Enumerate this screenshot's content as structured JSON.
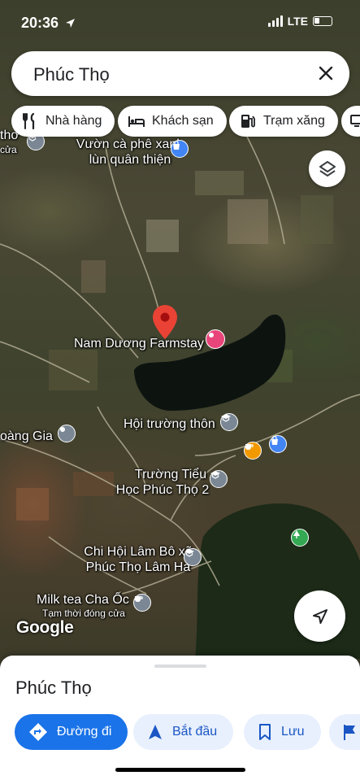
{
  "status_bar": {
    "time": "20:36",
    "network": "LTE"
  },
  "search": {
    "query": "Phúc Thọ"
  },
  "chips": [
    {
      "label": "Nhà hàng",
      "icon": "restaurant-icon"
    },
    {
      "label": "Khách sạn",
      "icon": "hotel-icon"
    },
    {
      "label": "Trạm xăng",
      "icon": "gas-station-icon"
    }
  ],
  "map": {
    "attribution": "Google",
    "labels": {
      "tho": "thơ",
      "cua": "cửa",
      "cafe_line1": "Vườn cà phê xanh",
      "cafe_line2": "lùn quân thiện",
      "farmstay": "Nam Dương Farmstay",
      "hall": "Hội trường thôn",
      "hoang_gia": "oàng Gia",
      "school_line1": "Trường Tiểu",
      "school_line2": "Học Phúc Thọ 2",
      "chihoi_line1": "Chi Hội Lâm Bô xã",
      "chihoi_line2": "Phúc Thọ Lâm Hà",
      "milktea": "Milk tea Cha Ốc",
      "milktea_status": "Tạm thời đóng cửa"
    }
  },
  "sheet": {
    "title": "Phúc Thọ",
    "actions": [
      {
        "label": "Đường đi",
        "icon": "directions-icon"
      },
      {
        "label": "Bắt đầu",
        "icon": "navigation-arrow-icon"
      },
      {
        "label": "Lưu",
        "icon": "bookmark-icon"
      }
    ]
  },
  "colors": {
    "accent": "#1a73e8",
    "pin": "#ea4335",
    "school_poi": "#7b8794",
    "cafe_poi": "#f29900",
    "shop_poi": "#4285f4",
    "park_poi": "#34a853"
  }
}
